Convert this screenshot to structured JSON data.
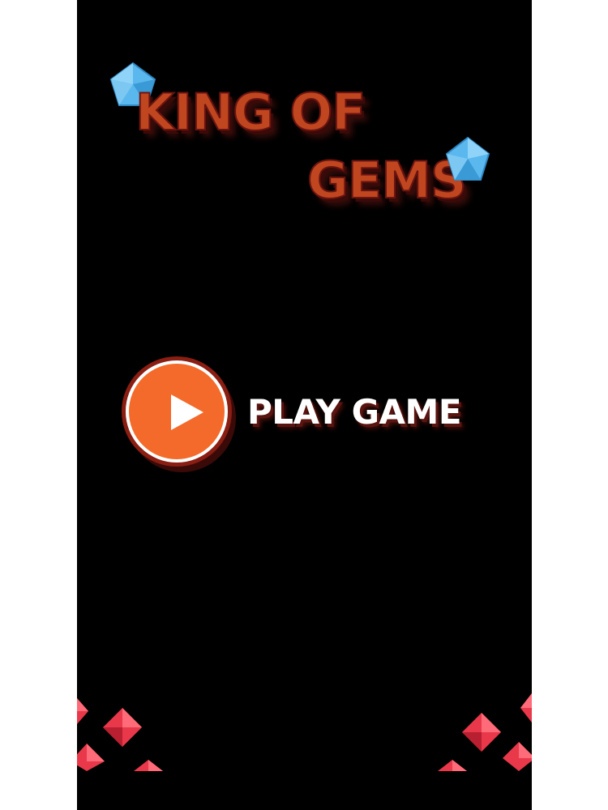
{
  "game": {
    "title_line_1": "KING OF",
    "title_line_2": "GEMS"
  },
  "menu": {
    "play_label": "PLAY GAME",
    "play_icon": "play-icon"
  },
  "decorations": {
    "title_gems": "blue-gem-icon",
    "corner_gems": "red-gem-icon"
  },
  "colors": {
    "background": "#000000",
    "title_fill": "#c0461f",
    "title_outline": "#6b1410",
    "play_button": "#f36a2a",
    "play_text": "#ffffff",
    "blue_gem": "#5ab8ee",
    "red_gem": "#e8384a"
  }
}
